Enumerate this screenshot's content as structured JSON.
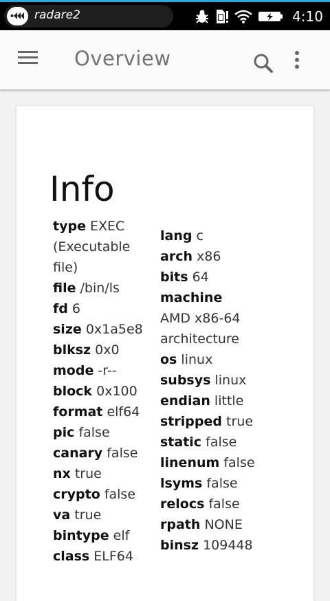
{
  "status_bar": {
    "app_name": "radare2",
    "time": "4:10",
    "icons": [
      "radare2-logo-icon",
      "bug-icon",
      "sim-alert-icon",
      "wifi-icon",
      "battery-charging-icon"
    ]
  },
  "toolbar": {
    "title": "Overview",
    "icons": [
      "menu-icon",
      "search-icon",
      "more-vertical-icon"
    ]
  },
  "card": {
    "title": "Info",
    "left": [
      {
        "key": "type",
        "value": "EXEC (Executable file)"
      },
      {
        "key": "file",
        "value": "/bin/ls"
      },
      {
        "key": "fd",
        "value": "6"
      },
      {
        "key": "size",
        "value": "0x1a5e8"
      },
      {
        "key": "blksz",
        "value": "0x0"
      },
      {
        "key": "mode",
        "value": "-r--"
      },
      {
        "key": "block",
        "value": "0x100"
      },
      {
        "key": "format",
        "value": "elf64"
      },
      {
        "key": "pic",
        "value": "false"
      },
      {
        "key": "canary",
        "value": "false"
      },
      {
        "key": "nx",
        "value": "true"
      },
      {
        "key": "crypto",
        "value": "false"
      },
      {
        "key": "va",
        "value": "true"
      },
      {
        "key": "bintype",
        "value": "elf"
      },
      {
        "key": "class",
        "value": "ELF64"
      }
    ],
    "right": [
      {
        "key": "lang",
        "value": "c"
      },
      {
        "key": "arch",
        "value": "x86"
      },
      {
        "key": "bits",
        "value": "64"
      },
      {
        "key": "machine",
        "value": "AMD x86-64 architecture"
      },
      {
        "key": "os",
        "value": "linux"
      },
      {
        "key": "subsys",
        "value": "linux"
      },
      {
        "key": "endian",
        "value": "little"
      },
      {
        "key": "stripped",
        "value": "true"
      },
      {
        "key": "static",
        "value": "false"
      },
      {
        "key": "linenum",
        "value": "false"
      },
      {
        "key": "lsyms",
        "value": "false"
      },
      {
        "key": "relocs",
        "value": "false"
      },
      {
        "key": "rpath",
        "value": "NONE"
      },
      {
        "key": "binsz",
        "value": "109448"
      }
    ]
  }
}
